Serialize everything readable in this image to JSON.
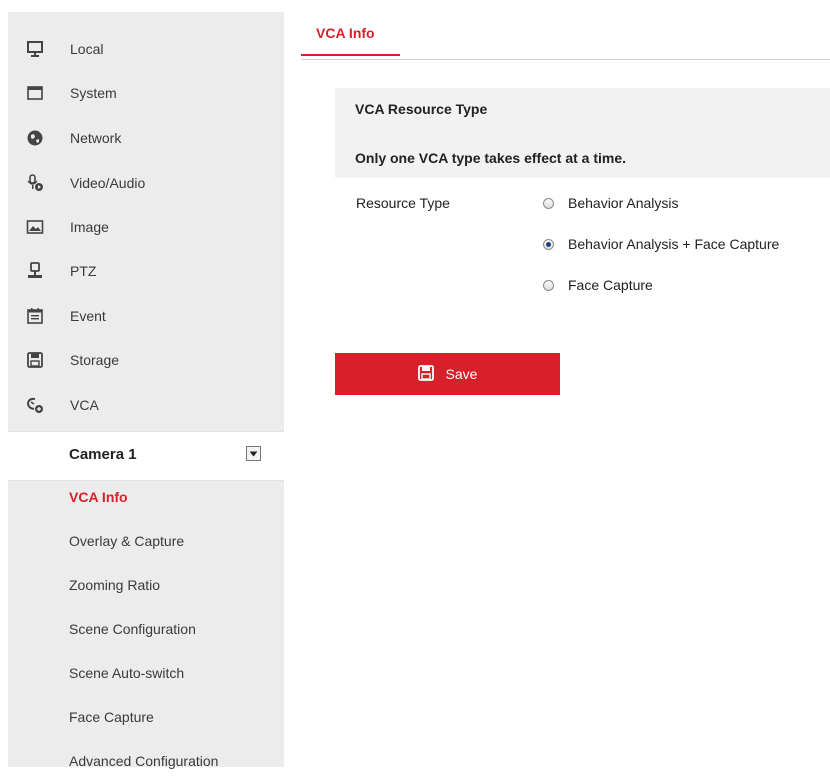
{
  "sidebar": {
    "items": [
      {
        "label": "Local",
        "icon": "monitor-icon"
      },
      {
        "label": "System",
        "icon": "system-icon"
      },
      {
        "label": "Network",
        "icon": "globe-icon"
      },
      {
        "label": "Video/Audio",
        "icon": "microphone-icon"
      },
      {
        "label": "Image",
        "icon": "image-icon"
      },
      {
        "label": "PTZ",
        "icon": "ptz-icon"
      },
      {
        "label": "Event",
        "icon": "calendar-icon"
      },
      {
        "label": "Storage",
        "icon": "floppy-icon"
      },
      {
        "label": "VCA",
        "icon": "vca-icon"
      }
    ],
    "camera": {
      "label": "Camera 1"
    },
    "sub_items": [
      {
        "label": "VCA Info",
        "active": true
      },
      {
        "label": "Overlay & Capture"
      },
      {
        "label": "Zooming Ratio"
      },
      {
        "label": "Scene Configuration"
      },
      {
        "label": "Scene Auto-switch"
      },
      {
        "label": "Face Capture"
      },
      {
        "label": "Advanced Configuration"
      }
    ]
  },
  "main": {
    "tab_label": "VCA Info",
    "section_title": "VCA Resource Type",
    "section_note": "Only one VCA type takes effect at a time.",
    "field_label": "Resource Type",
    "options": [
      {
        "label": "Behavior Analysis",
        "checked": false
      },
      {
        "label": "Behavior Analysis + Face Capture",
        "checked": true
      },
      {
        "label": "Face Capture",
        "checked": false
      }
    ],
    "save_label": "Save"
  },
  "colors": {
    "accent": "#d7202a",
    "sidebar_bg": "#ececec",
    "section_bg": "#f2f2f2"
  }
}
